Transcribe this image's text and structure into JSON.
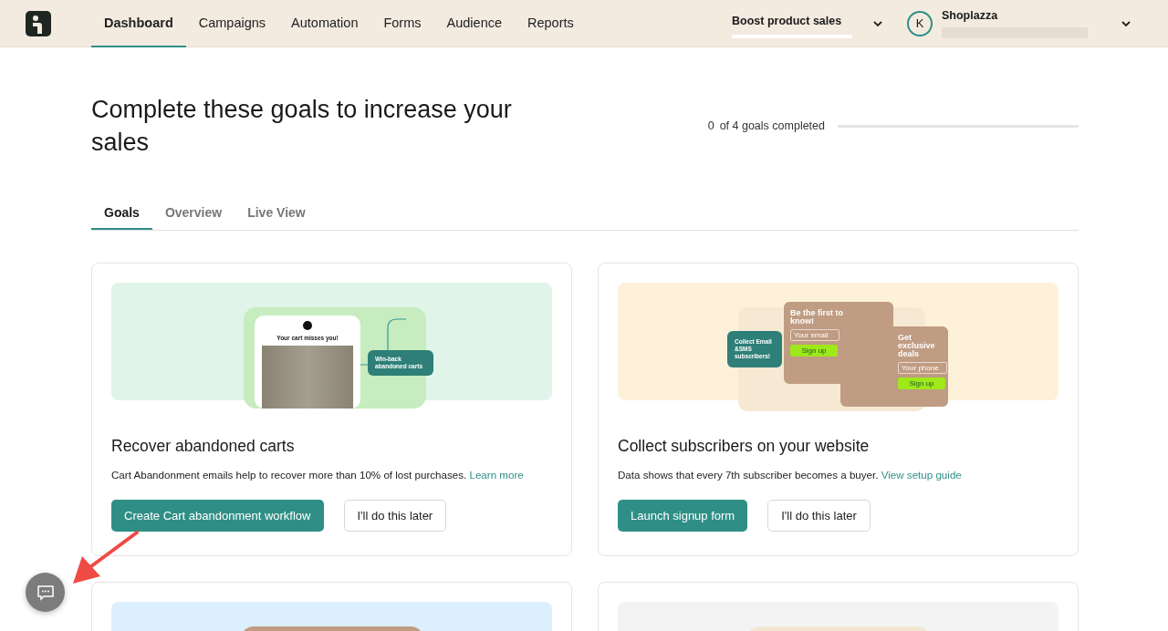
{
  "nav": {
    "items": [
      {
        "label": "Dashboard",
        "selected": true
      },
      {
        "label": "Campaigns",
        "selected": false
      },
      {
        "label": "Automation",
        "selected": false
      },
      {
        "label": "Forms",
        "selected": false
      },
      {
        "label": "Audience",
        "selected": false
      },
      {
        "label": "Reports",
        "selected": false
      }
    ],
    "goal_select": {
      "value": "Boost product sales"
    },
    "account": {
      "initial": "K",
      "name": "Shoplazza"
    }
  },
  "heading": "Complete these goals to increase your sales",
  "progress": {
    "count": "0",
    "label": "of 4 goals completed",
    "level": 0
  },
  "tabs": [
    {
      "label": "Goals",
      "selected": true
    },
    {
      "label": "Overview",
      "selected": false
    },
    {
      "label": "Live View",
      "selected": false
    }
  ],
  "cards": [
    {
      "kind": "cart",
      "title": "Recover abandoned carts",
      "description": "Cart Abandonment emails help to recover more than 10% of lost purchases.",
      "link": "Learn more",
      "primary": "Create Cart abandonment workflow",
      "secondary": "I'll do this later",
      "art": {
        "headline": "Your cart misses you!",
        "tag": "Win-back abandoned carts"
      }
    },
    {
      "kind": "signup",
      "title": "Collect subscribers on your website",
      "description": "Data shows that every 7th subscriber becomes a buyer.",
      "link": "View setup guide",
      "primary": "Launch signup form",
      "secondary": "I'll do this later",
      "art": {
        "tag": "Collect Email &SMS subscribers!",
        "form1": {
          "headline": "Be the first to know!",
          "field": "Your email",
          "button": "Sign up"
        },
        "form2": {
          "headline": "Get exclusive deals",
          "field": "Your phone",
          "button": "Sign up"
        }
      }
    },
    {
      "kind": "blue"
    },
    {
      "kind": "grey"
    }
  ]
}
